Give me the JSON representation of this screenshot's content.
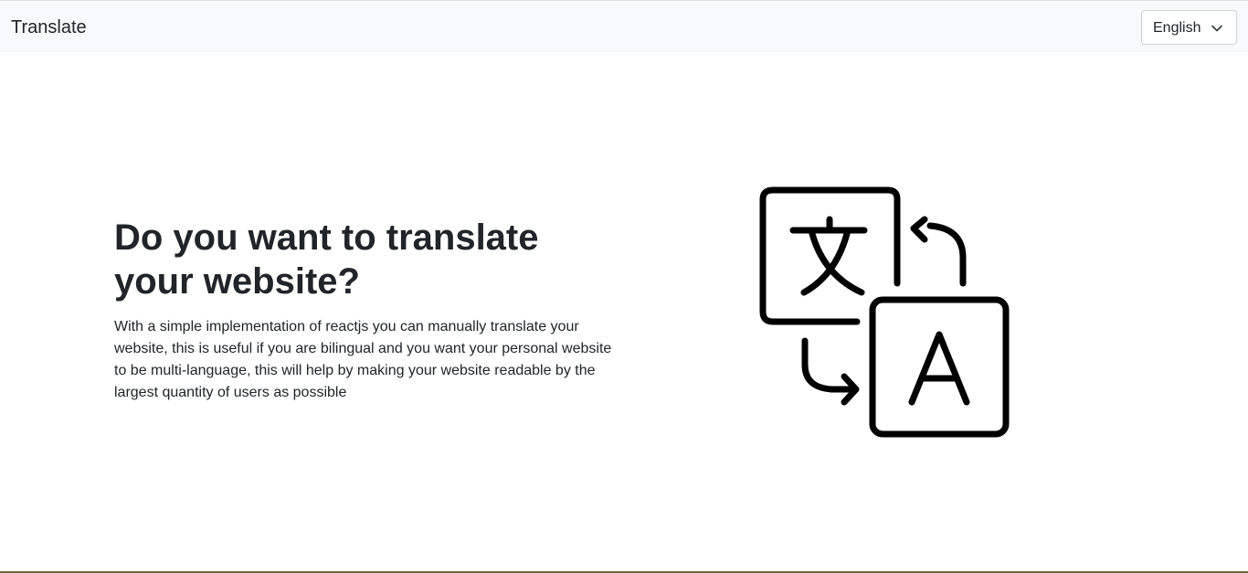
{
  "navbar": {
    "brand": "Translate",
    "language_select": {
      "selected": "English"
    }
  },
  "hero": {
    "title": "Do you want to translate your website?",
    "description": "With a simple implementation of reactjs you can manually translate your website, this is useful if you are bilingual and you want your personal website to be multi-language, this will help by making your website readable by the largest quantity of users as possible"
  },
  "illustration": {
    "icon": "translate-icon",
    "glyph_source": "文",
    "glyph_target": "A"
  }
}
